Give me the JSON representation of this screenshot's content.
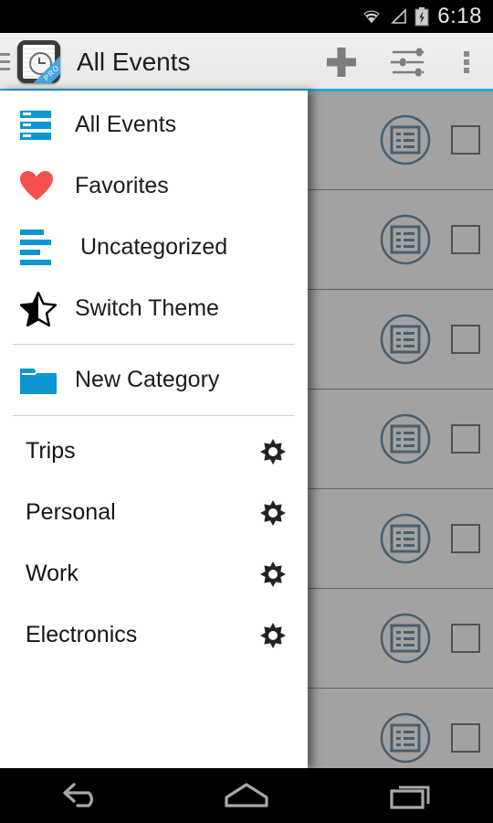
{
  "statusbar": {
    "time": "6:18",
    "icons": [
      "wifi-icon",
      "cell-signal-icon",
      "battery-charging-icon"
    ]
  },
  "actionbar": {
    "title": "All Events",
    "app_icon": "notepad-clock-icon",
    "app_icon_badge": "PRO",
    "drawer_toggle": "hamburger-icon",
    "actions": [
      {
        "name": "add-button",
        "icon": "plus-icon"
      },
      {
        "name": "filter-button",
        "icon": "sliders-icon"
      },
      {
        "name": "overflow-button",
        "icon": "overflow-dots-icon"
      }
    ],
    "accent_color": "#27a8dd"
  },
  "drawer": {
    "nav_items": [
      {
        "label": "All Events",
        "icon": "list-bars-icon",
        "icon_color": "#0d96cf"
      },
      {
        "label": "Favorites",
        "icon": "heart-icon",
        "icon_color": "#f4504d"
      },
      {
        "label": "Uncategorized",
        "icon": "uncategorized-bars-icon",
        "icon_color": "#0d96cf"
      },
      {
        "label": "Switch Theme",
        "icon": "half-star-icon",
        "icon_color": "#000000"
      }
    ],
    "new_category": {
      "label": "New Category",
      "icon": "folder-icon",
      "icon_color": "#0d96cf"
    },
    "categories": [
      {
        "label": "Trips",
        "settings_icon": "gear-icon"
      },
      {
        "label": "Personal",
        "settings_icon": "gear-icon"
      },
      {
        "label": "Work",
        "settings_icon": "gear-icon"
      },
      {
        "label": "Electronics",
        "settings_icon": "gear-icon"
      }
    ]
  },
  "content": {
    "row_icon": "circled-list-icon",
    "row_checkbox": "checkbox-unchecked",
    "row_count": 7,
    "scrim_color": "#5f5f5f",
    "row_icon_color": "#2d5e82"
  },
  "navbar": {
    "buttons": [
      {
        "name": "back-button",
        "icon": "back-arrow-icon"
      },
      {
        "name": "home-button",
        "icon": "home-icon"
      },
      {
        "name": "recents-button",
        "icon": "recents-icon"
      }
    ]
  }
}
